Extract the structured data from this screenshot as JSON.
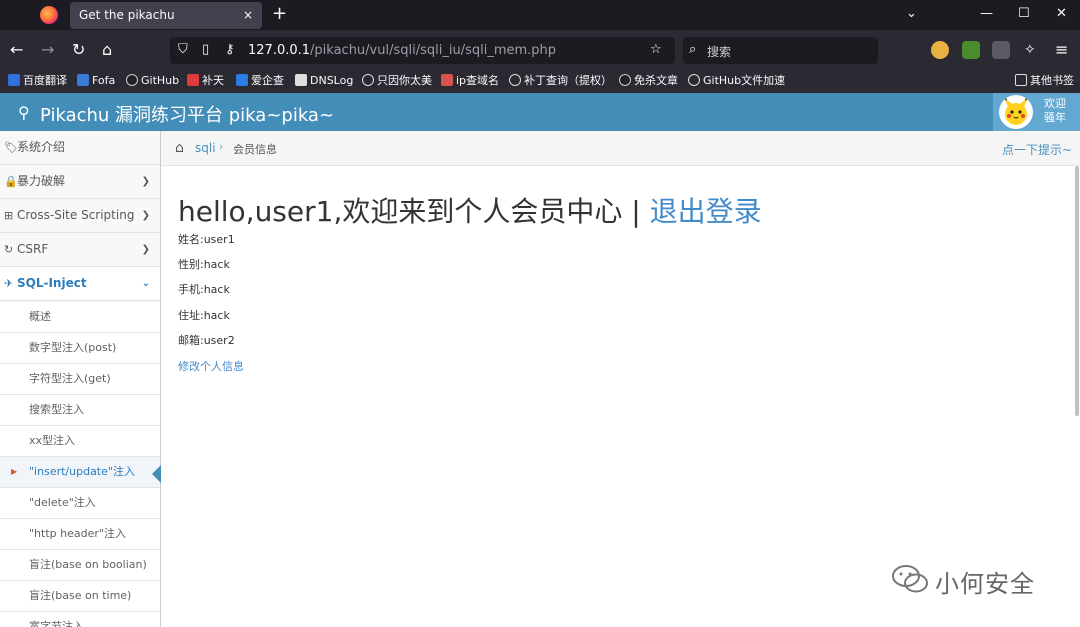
{
  "browser": {
    "tab_title": "Get the pikachu",
    "tab_close": "×",
    "new_tab": "+",
    "url_host": "127.0.0.1",
    "url_path": "/pikachu/vul/sqli/sqli_iu/sqli_mem.php",
    "search_placeholder": "搜索",
    "bookmarks": [
      "百度翻译",
      "Fofa",
      "GitHub",
      "补天",
      "爱企查",
      "DNSLog",
      "只因你太美",
      "ip查域名",
      "补丁查询（提权）",
      "免杀文章",
      "GitHub文件加速"
    ],
    "other_bookmarks": "其他书签",
    "colors": {
      "tabbar": "#1c1b22",
      "toolbar": "#2b2a33"
    }
  },
  "site": {
    "title": "Pikachu 漏洞练习平台 pika~pika~",
    "welcome_line1": "欢迎",
    "welcome_line2": "骚年",
    "header_color": "#438eb9"
  },
  "sidebar": {
    "items": [
      {
        "label": "系统介绍",
        "icon": "tag-icon"
      },
      {
        "label": "暴力破解",
        "icon": "lock-icon"
      },
      {
        "label": "Cross-Site Scripting",
        "icon": "sitemap-icon"
      },
      {
        "label": "CSRF",
        "icon": "refresh-icon"
      },
      {
        "label": "SQL-Inject",
        "icon": "plane-icon"
      }
    ],
    "subitems": [
      "概述",
      "数字型注入(post)",
      "字符型注入(get)",
      "搜索型注入",
      "xx型注入",
      "\"insert/update\"注入",
      "\"delete\"注入",
      "\"http header\"注入",
      "盲注(base on boolian)",
      "盲注(base on time)",
      "宽字节注入"
    ]
  },
  "breadcrumb": {
    "link": "sqli",
    "current": "会员信息",
    "hint": "点一下提示~"
  },
  "main": {
    "greeting": "hello,user1,欢迎来到个人会员中心 | ",
    "logout": "退出登录",
    "fields": [
      "姓名:user1",
      "性别:hack",
      "手机:hack",
      "住址:hack",
      "邮箱:user2"
    ],
    "edit_link": "修改个人信息"
  },
  "watermark": "小何安全"
}
